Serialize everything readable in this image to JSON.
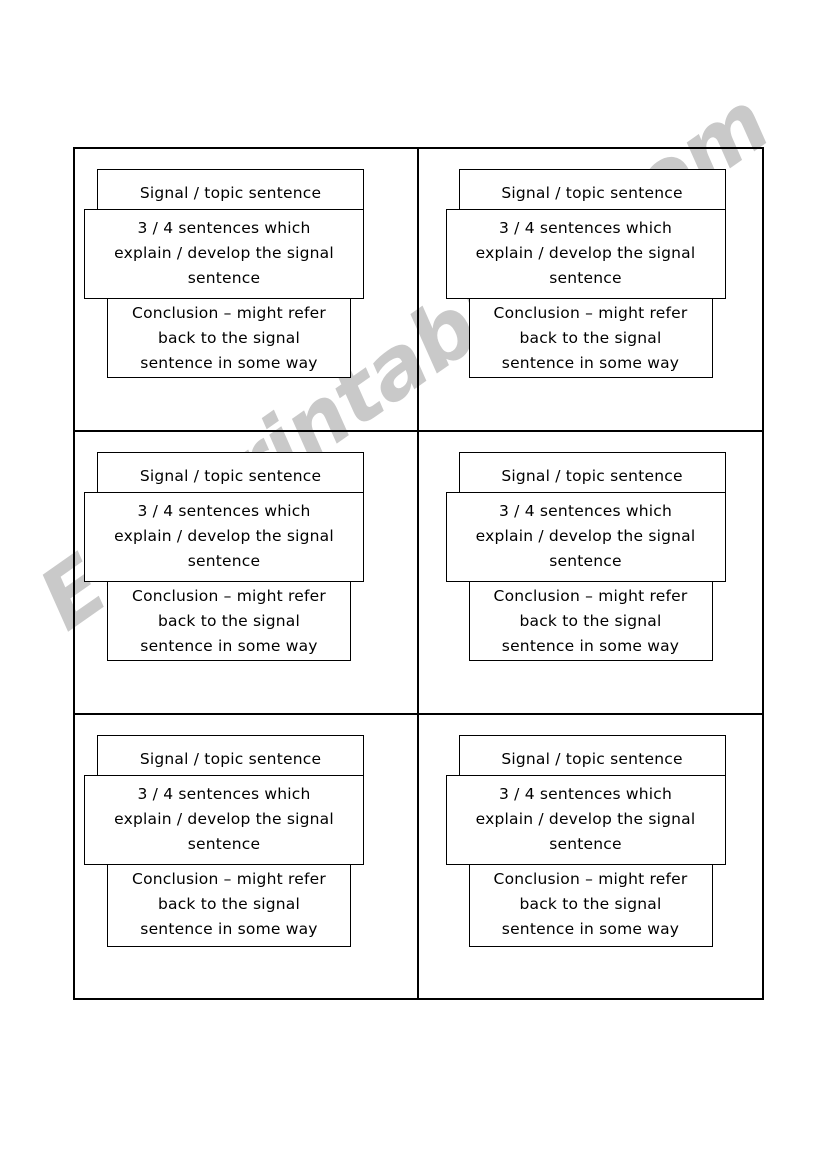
{
  "page": {
    "background_color": "#ffffff",
    "text_color": "#000000",
    "border_color": "#000000"
  },
  "watermark": {
    "text": "ESLprintables.com",
    "color": "#c9c9c9",
    "orientation": "diagonal-bottom-left-to-top-right"
  },
  "worksheet": {
    "columns": 2,
    "rows": 3,
    "total_cells": 6
  },
  "boxes": {
    "signal": {
      "label": "Signal / topic sentence"
    },
    "develop": {
      "line1": "3 / 4 sentences which",
      "line2": "explain / develop the signal",
      "line3": "sentence",
      "full_text": "3 / 4 sentences which explain / develop the signal sentence"
    },
    "conclusion": {
      "line1": "Conclusion – might refer",
      "line2": "back to the signal",
      "line3": "sentence in some way",
      "full_text": "Conclusion – might refer back to the signal sentence in some way"
    }
  },
  "cells": [
    {
      "id": "cell-1",
      "position": "row1-col1"
    },
    {
      "id": "cell-2",
      "position": "row1-col2"
    },
    {
      "id": "cell-3",
      "position": "row2-col1"
    },
    {
      "id": "cell-4",
      "position": "row2-col2"
    },
    {
      "id": "cell-5",
      "position": "row3-col1"
    },
    {
      "id": "cell-6",
      "position": "row3-col2"
    }
  ]
}
